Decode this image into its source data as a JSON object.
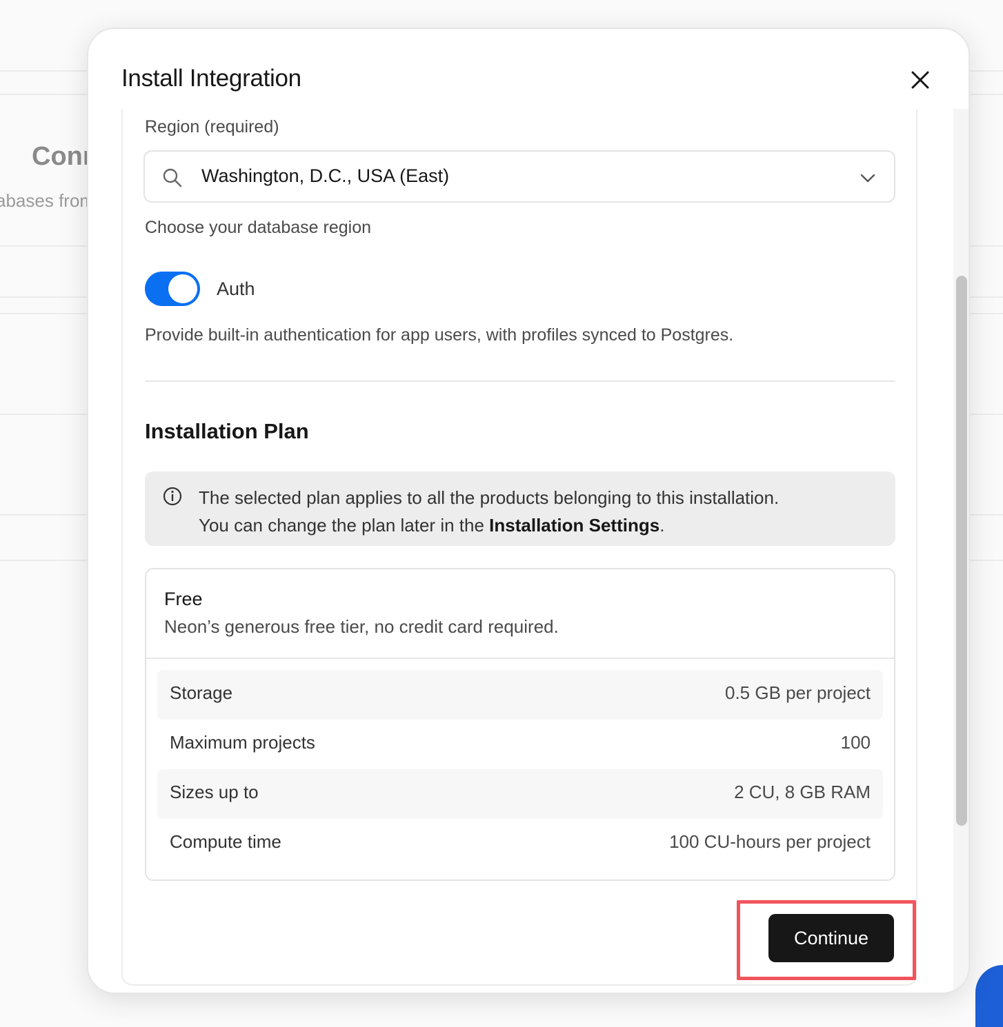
{
  "background": {
    "heading": "Conn",
    "subtext": "abases from"
  },
  "modal": {
    "title": "Install Integration",
    "close_icon": "close-icon"
  },
  "region": {
    "label": "Region (required)",
    "value": "Washington, D.C., USA (East)",
    "help": "Choose your database region"
  },
  "auth": {
    "label": "Auth",
    "enabled": true,
    "description": "Provide built-in authentication for app users, with profiles synced to Postgres."
  },
  "installation_plan": {
    "title": "Installation Plan",
    "notice_line1": "The selected plan applies to all the products belonging to this installation.",
    "notice_line2_prefix": "You can change the plan later in the ",
    "notice_link": "Installation Settings",
    "notice_line2_suffix": "."
  },
  "plan": {
    "name": "Free",
    "description": "Neon’s generous free tier, no credit card required.",
    "features": [
      {
        "label": "Storage",
        "value": "0.5 GB per project"
      },
      {
        "label": "Maximum projects",
        "value": "100"
      },
      {
        "label": "Sizes up to",
        "value": "2 CU, 8 GB RAM"
      },
      {
        "label": "Compute time",
        "value": "100 CU-hours per project"
      }
    ]
  },
  "actions": {
    "continue_label": "Continue"
  },
  "colors": {
    "accent": "#0b6ff2",
    "primary_button": "#171717",
    "highlight": "#f0545c"
  }
}
